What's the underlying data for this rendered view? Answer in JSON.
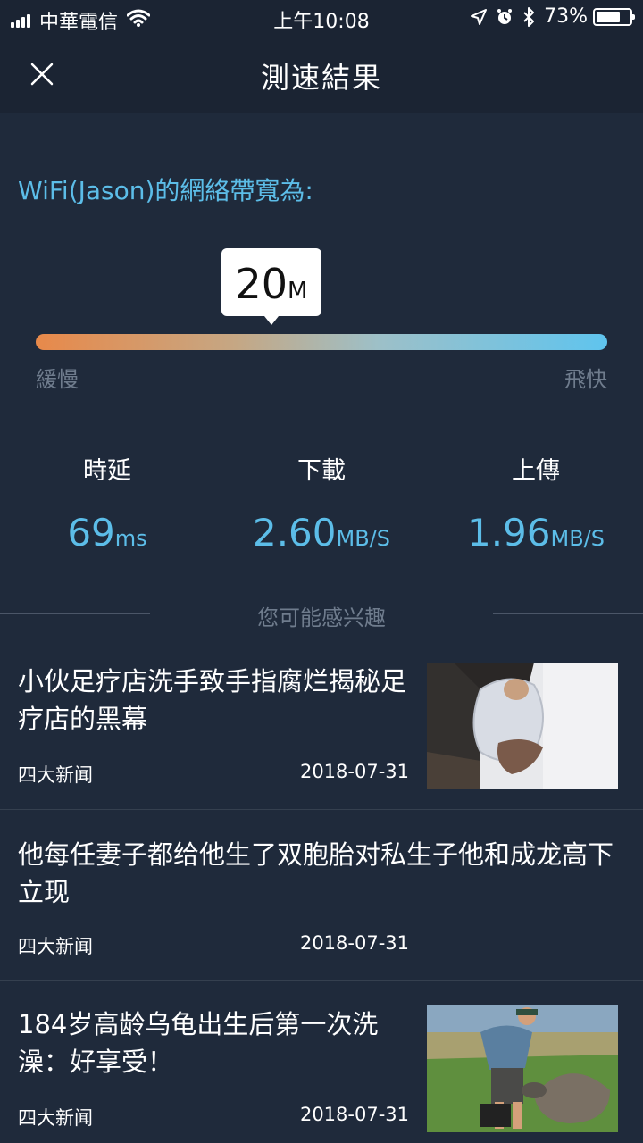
{
  "status_bar": {
    "carrier": "中華電信",
    "time": "上午10:08",
    "battery": "73%",
    "battery_level": 0.73
  },
  "nav": {
    "title": "測速結果",
    "close_icon": "close-icon"
  },
  "result": {
    "bandwidth_label": "WiFi(Jason)的網絡帶寬為:",
    "speed_value": "20",
    "speed_unit": "M",
    "slow_label": "緩慢",
    "fast_label": "飛快"
  },
  "metrics": [
    {
      "label": "時延",
      "value": "69",
      "unit": "ms"
    },
    {
      "label": "下載",
      "value": "2.60",
      "unit": "MB/S"
    },
    {
      "label": "上傳",
      "value": "1.96",
      "unit": "MB/S"
    }
  ],
  "recommend": {
    "title": "您可能感兴趣"
  },
  "news": [
    {
      "title": "小伙足疗店洗手致手指腐烂揭秘足疗店的黑幕",
      "source": "四大新闻",
      "date": "2018-07-31",
      "has_thumb": true
    },
    {
      "title": "他每任妻子都给他生了双胞胎对私生子他和成龙高下立现",
      "source": "四大新闻",
      "date": "2018-07-31",
      "has_thumb": false
    },
    {
      "title": "184岁高龄乌龟出生后第一次洗澡：好享受！",
      "source": "四大新闻",
      "date": "2018-07-31",
      "has_thumb": true
    }
  ],
  "colors": {
    "background": "#1f2a3b",
    "header": "#1b2433",
    "accent": "#5cbde8",
    "muted": "#6f7c8d"
  }
}
